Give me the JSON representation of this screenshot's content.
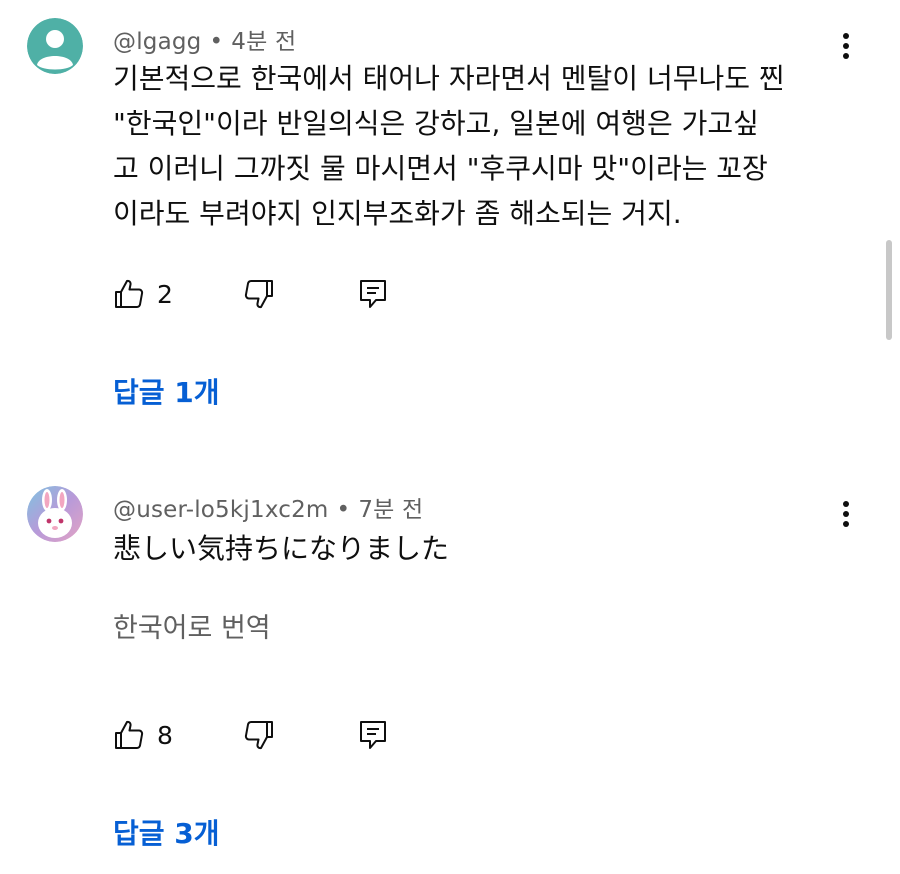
{
  "comments": [
    {
      "author": "@lgagg",
      "time": "4분 전",
      "avatar_color": "#4fb0a6",
      "text_lines": [
        "기본적으로 한국에서 태어나 자라면서 멘탈이 너무나도 찐",
        "\"한국인\"이라 반일의식은 강하고, 일본에 여행은 가고싶",
        "고 이러니 그까짓 물 마시면서 \"후쿠시마 맛\"이라는 꼬장",
        "이라도 부려야지 인지부조화가 좀 해소되는 거지."
      ],
      "likes": "2",
      "replies_label": "답글 1개"
    },
    {
      "author": "@user-lo5kj1xc2m",
      "time": "7분 전",
      "avatar_color": "#a98bd6",
      "text_lines": [
        "悲しい気持ちになりました"
      ],
      "translate_label": "한국어로 번역",
      "likes": "8",
      "replies_label": "답글 3개"
    }
  ],
  "icons": {
    "like": "thumbs-up-icon",
    "dislike": "thumbs-down-icon",
    "reply": "reply-icon",
    "more": "more-vertical-icon"
  },
  "colors": {
    "link_blue": "#065fd4",
    "secondary_text": "#606060"
  }
}
